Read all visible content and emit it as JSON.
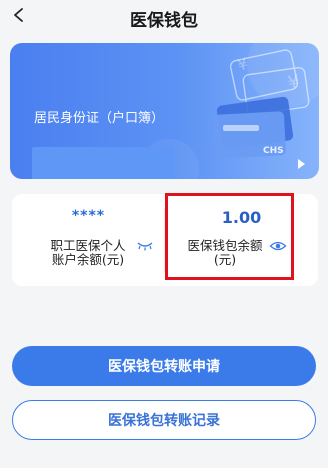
{
  "header": {
    "title": "医保钱包",
    "back_icon": "back-arrow-icon"
  },
  "card": {
    "id_type": "居民身份证（户口簿）",
    "brand_text": "CHS",
    "colors": {
      "gradient_start": "#4a7ff0",
      "gradient_end": "#86b3fb"
    }
  },
  "balances": {
    "personal": {
      "value": "****",
      "label_line1": "职工医保个人",
      "label_line2": "账户余额(元)",
      "visibility_icon": "eye-closed-icon"
    },
    "wallet": {
      "value": "1.00",
      "label_line1": "医保钱包余额",
      "label_line2": "(元)",
      "visibility_icon": "eye-open-icon"
    }
  },
  "actions": {
    "transfer_apply": "医保钱包转账申请",
    "transfer_records": "医保钱包转账记录"
  },
  "colors": {
    "accent": "#3a7be9",
    "highlight": "#e0131d"
  }
}
